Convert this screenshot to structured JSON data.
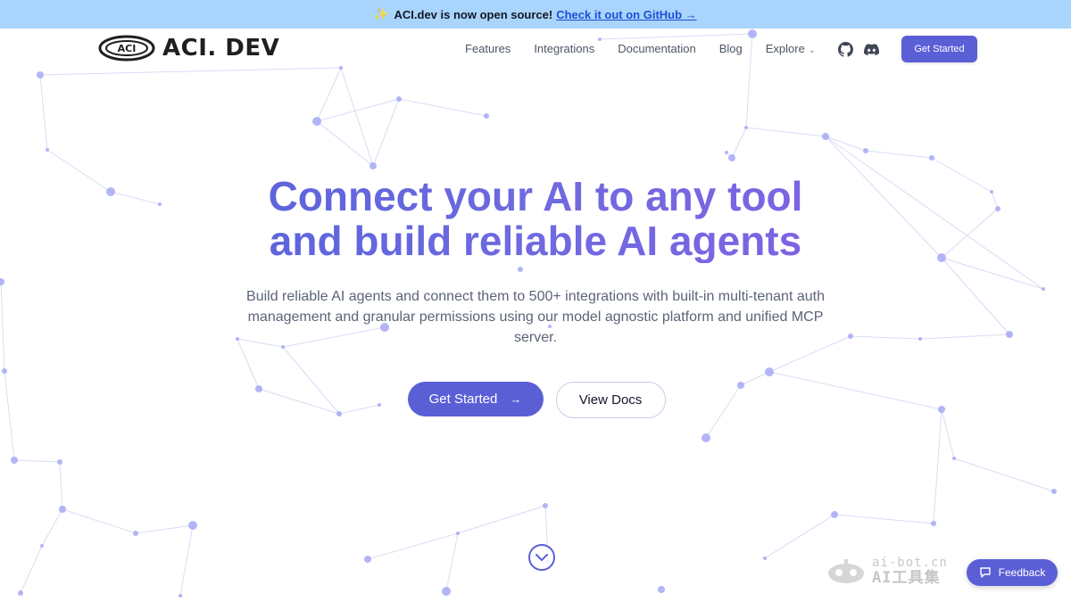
{
  "banner": {
    "icon": "sparkle-icon",
    "text": "ACI.dev is now open source!",
    "link_text": "Check it out on GitHub →"
  },
  "nav": {
    "logo_badge": "ACI",
    "logo_text": "ACI. DEV",
    "links": [
      {
        "label": "Features"
      },
      {
        "label": "Integrations"
      },
      {
        "label": "Documentation"
      },
      {
        "label": "Blog"
      },
      {
        "label": "Explore",
        "icon": "chevron-down-icon"
      }
    ],
    "icons": [
      "github-icon",
      "discord-icon"
    ],
    "cta_label": "Get Started"
  },
  "hero": {
    "title_line1": "Connect your AI to any tool",
    "title_line2": "and build reliable AI agents",
    "subtitle": "Build reliable AI agents and connect them to 500+ integrations with built-in multi-tenant auth management and granular permissions using our model agnostic platform and unified MCP server.",
    "primary_button": "Get Started",
    "secondary_button": "View Docs"
  },
  "watermark": {
    "line1": "ai-bot.cn",
    "line2": "AI工具集"
  },
  "feedback": {
    "label": "Feedback",
    "icon": "feedback-icon"
  },
  "colors": {
    "banner_bg": "#a9d4fb",
    "accent": "#5b5fd6",
    "title_gradient_start": "#4b5fd8",
    "title_gradient_end": "#8b5ce6",
    "network_node": "#a5a9f4"
  }
}
